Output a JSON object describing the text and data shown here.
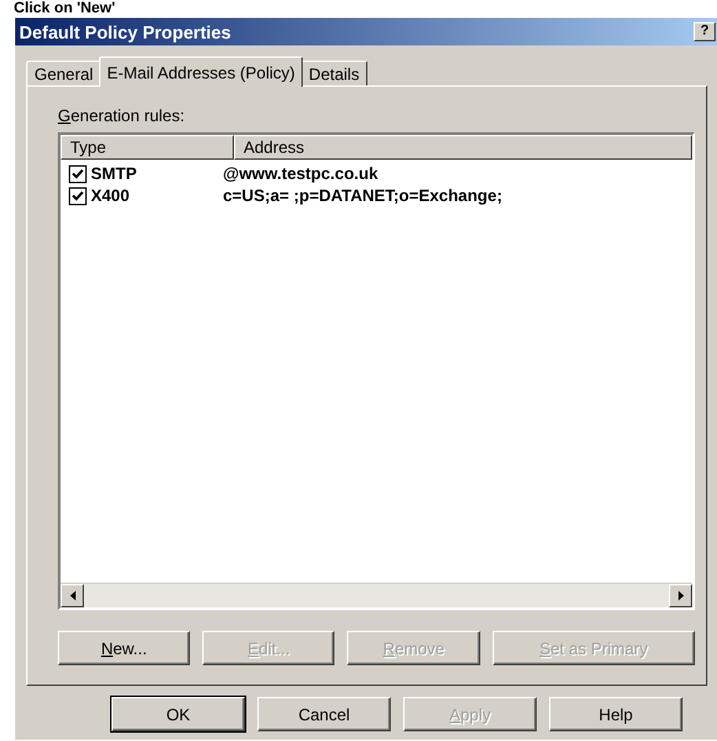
{
  "caption": "Click on 'New'",
  "window": {
    "title": "Default Policy Properties",
    "title_buttons": [
      "?"
    ]
  },
  "tabs": [
    {
      "label": "General",
      "selected": false
    },
    {
      "label": "E-Mail Addresses (Policy)",
      "selected": true
    },
    {
      "label": "Details",
      "selected": false
    }
  ],
  "list_label": {
    "text": "Generation rules:",
    "mnemonic": true
  },
  "table": {
    "columns": [
      "Type",
      "Address"
    ],
    "rows": [
      {
        "type": "SMTP",
        "address": "@www.testpc.co.uk",
        "checked": true
      },
      {
        "type": "X400",
        "address": "c=US;a= ;p=DATANET;o=Exchange;",
        "checked": true
      }
    ]
  },
  "list_buttons": [
    {
      "label": "New...",
      "disabled": false,
      "mnemonic": true
    },
    {
      "label": "Edit...",
      "disabled": true,
      "mnemonic": true
    },
    {
      "label": "Remove",
      "disabled": true,
      "mnemonic": true
    },
    {
      "label": "Set as Primary",
      "disabled": true,
      "mnemonic": true
    }
  ],
  "dialog_buttons": [
    {
      "label": "OK",
      "disabled": false,
      "default": true,
      "mnemonic": false
    },
    {
      "label": "Cancel",
      "disabled": false,
      "default": false,
      "mnemonic": false
    },
    {
      "label": "Apply",
      "disabled": true,
      "default": false,
      "mnemonic": true
    },
    {
      "label": "Help",
      "disabled": false,
      "default": false,
      "mnemonic": false
    }
  ]
}
